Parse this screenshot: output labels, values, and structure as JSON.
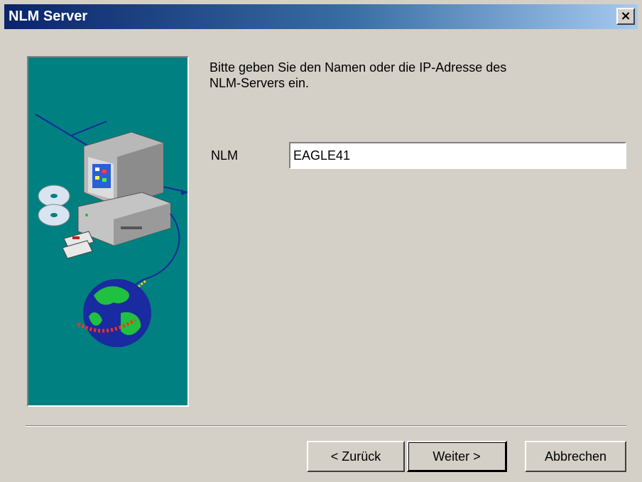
{
  "window": {
    "title": "NLM Server",
    "close_label": "×"
  },
  "main": {
    "prompt": "Bitte geben Sie den Namen oder die IP-Adresse des\nNLM-Servers ein.",
    "nlm_label": "NLM",
    "nlm_value": "EAGLE41"
  },
  "buttons": {
    "back": "< Zurück",
    "next": "Weiter >",
    "cancel": "Abbrechen"
  },
  "icons": [
    "close-icon",
    "computer-icon",
    "cd-icon",
    "floppy-icon",
    "globe-icon"
  ],
  "colors": {
    "title_bar_start": "#0a246a",
    "title_bar_end": "#a6caf0",
    "illustration_bg": "#008080",
    "dialog_bg": "#d4d0c8"
  }
}
